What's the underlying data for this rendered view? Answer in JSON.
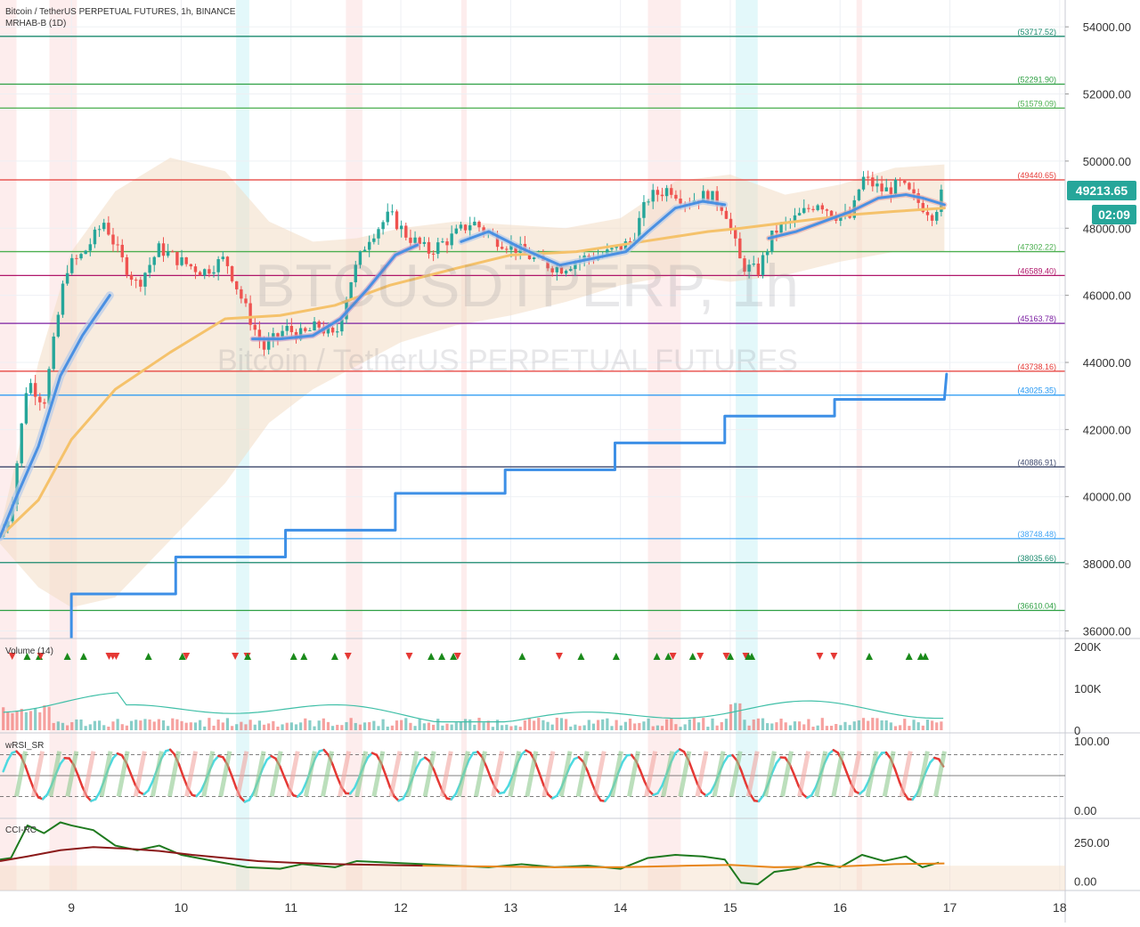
{
  "header": {
    "symbol_title": "Bitcoin / TetherUS PERPETUAL FUTURES, 1h, BINANCE",
    "indicator_title": "MRHAB-B (1D)"
  },
  "watermark": {
    "ticker": "BTCUSDTPERP, 1h",
    "name": "Bitcoin / TetherUS PERPETUAL FUTURES"
  },
  "panes": {
    "volume_label": "Volume (14)",
    "wrsi_label": "wRSI_SR",
    "cci_label": "CCI-RC"
  },
  "last_price": {
    "value": "49213.65",
    "countdown": "02:09"
  },
  "colors": {
    "up": "#26a69a",
    "down": "#ef5350",
    "ema_fast": "#4a90e2",
    "ema_slow": "#f5c26b",
    "band": "#f3dcc4",
    "step_line": "#3d8fe6",
    "cci_line": "#1f7a1f",
    "cci_signal": "#8b1a1a"
  },
  "chart_data": [
    {
      "type": "candlestick",
      "title": "Bitcoin / TetherUS PERPETUAL FUTURES, 1h, BINANCE",
      "x_ticks": [
        "9",
        "10",
        "11",
        "12",
        "13",
        "14",
        "15",
        "16",
        "17",
        "18"
      ],
      "y_ticks": [
        "54000.00",
        "52000.00",
        "50000.00",
        "48000.00",
        "46000.00",
        "44000.00",
        "42000.00",
        "40000.00",
        "38000.00",
        "36000.00"
      ],
      "ylim": [
        35800,
        54800
      ],
      "xlim": [
        8.35,
        18.05
      ],
      "price_path": [
        [
          8.35,
          38800
        ],
        [
          8.45,
          39600
        ],
        [
          8.6,
          43500
        ],
        [
          8.75,
          42800
        ],
        [
          8.95,
          46800
        ],
        [
          9.1,
          47200
        ],
        [
          9.3,
          48200
        ],
        [
          9.45,
          47100
        ],
        [
          9.6,
          46300
        ],
        [
          9.8,
          47400
        ],
        [
          10.0,
          47000
        ],
        [
          10.2,
          46700
        ],
        [
          10.4,
          47100
        ],
        [
          10.6,
          45500
        ],
        [
          10.75,
          44400
        ],
        [
          10.95,
          45000
        ],
        [
          11.1,
          44800
        ],
        [
          11.25,
          45100
        ],
        [
          11.4,
          44700
        ],
        [
          11.55,
          46500
        ],
        [
          11.7,
          47700
        ],
        [
          11.9,
          48400
        ],
        [
          12.05,
          47800
        ],
        [
          12.25,
          47300
        ],
        [
          12.45,
          47700
        ],
        [
          12.65,
          48200
        ],
        [
          12.85,
          47700
        ],
        [
          13.05,
          47400
        ],
        [
          13.25,
          47000
        ],
        [
          13.45,
          46800
        ],
        [
          13.65,
          47100
        ],
        [
          13.85,
          47200
        ],
        [
          14.1,
          47600
        ],
        [
          14.25,
          48900
        ],
        [
          14.45,
          49200
        ],
        [
          14.6,
          48800
        ],
        [
          14.8,
          49000
        ],
        [
          14.95,
          48600
        ],
        [
          15.1,
          46900
        ],
        [
          15.25,
          46700
        ],
        [
          15.4,
          47900
        ],
        [
          15.6,
          48300
        ],
        [
          15.8,
          48800
        ],
        [
          15.95,
          48400
        ],
        [
          16.1,
          48300
        ],
        [
          16.2,
          49500
        ],
        [
          16.4,
          49100
        ],
        [
          16.55,
          49300
        ],
        [
          16.7,
          48800
        ],
        [
          16.85,
          48400
        ],
        [
          16.95,
          49213.65
        ]
      ],
      "ema_fast": [
        [
          8.35,
          38800
        ],
        [
          8.5,
          40000
        ],
        [
          8.7,
          41500
        ],
        [
          8.9,
          43600
        ],
        [
          9.1,
          44800
        ],
        [
          9.35,
          46000
        ]
      ],
      "ema_fast_2": [
        [
          10.65,
          44700
        ],
        [
          10.9,
          44700
        ],
        [
          11.2,
          44800
        ],
        [
          11.45,
          45300
        ],
        [
          11.7,
          46200
        ],
        [
          11.95,
          47200
        ],
        [
          12.15,
          47500
        ]
      ],
      "ema_fast_3": [
        [
          12.55,
          47600
        ],
        [
          12.8,
          47900
        ],
        [
          13.1,
          47400
        ],
        [
          13.45,
          46900
        ],
        [
          13.75,
          47100
        ],
        [
          14.05,
          47300
        ],
        [
          14.25,
          47900
        ],
        [
          14.5,
          48600
        ],
        [
          14.75,
          48800
        ],
        [
          14.95,
          48700
        ]
      ],
      "ema_fast_4": [
        [
          15.35,
          47700
        ],
        [
          15.6,
          47900
        ],
        [
          15.85,
          48200
        ],
        [
          16.1,
          48500
        ],
        [
          16.35,
          48900
        ],
        [
          16.6,
          49000
        ],
        [
          16.75,
          48900
        ],
        [
          16.95,
          48700
        ]
      ],
      "ema_slow": [
        [
          8.35,
          38800
        ],
        [
          8.7,
          39900
        ],
        [
          9.0,
          41700
        ],
        [
          9.4,
          43200
        ],
        [
          9.9,
          44300
        ],
        [
          10.4,
          45300
        ],
        [
          10.9,
          45400
        ],
        [
          11.4,
          45700
        ],
        [
          11.9,
          46300
        ],
        [
          12.5,
          46800
        ],
        [
          13.0,
          47200
        ],
        [
          13.6,
          47300
        ],
        [
          14.2,
          47600
        ],
        [
          14.8,
          47900
        ],
        [
          15.1,
          48000
        ],
        [
          15.6,
          48200
        ],
        [
          16.1,
          48400
        ],
        [
          16.5,
          48500
        ],
        [
          16.95,
          48600
        ]
      ],
      "band_upper": [
        [
          8.35,
          39000
        ],
        [
          8.7,
          44000
        ],
        [
          9.0,
          47300
        ],
        [
          9.4,
          49100
        ],
        [
          9.9,
          50100
        ],
        [
          10.4,
          49700
        ],
        [
          10.8,
          48200
        ],
        [
          11.2,
          47600
        ],
        [
          11.6,
          47700
        ],
        [
          12.0,
          48000
        ],
        [
          12.5,
          48200
        ],
        [
          13.0,
          48100
        ],
        [
          13.5,
          48000
        ],
        [
          14.0,
          48300
        ],
        [
          14.5,
          49400
        ],
        [
          15.0,
          49600
        ],
        [
          15.5,
          49000
        ],
        [
          16.0,
          49300
        ],
        [
          16.5,
          49800
        ],
        [
          16.95,
          49900
        ]
      ],
      "band_lower": [
        [
          16.95,
          47300
        ],
        [
          16.5,
          47300
        ],
        [
          16.0,
          47000
        ],
        [
          15.5,
          46600
        ],
        [
          15.0,
          46400
        ],
        [
          14.5,
          46600
        ],
        [
          14.0,
          46300
        ],
        [
          13.5,
          45800
        ],
        [
          13.0,
          45400
        ],
        [
          12.5,
          45100
        ],
        [
          12.0,
          44600
        ],
        [
          11.6,
          43900
        ],
        [
          11.2,
          43200
        ],
        [
          10.8,
          42200
        ],
        [
          10.4,
          40400
        ],
        [
          9.9,
          38700
        ],
        [
          9.4,
          37000
        ],
        [
          9.0,
          36700
        ],
        [
          8.7,
          37300
        ],
        [
          8.35,
          38600
        ]
      ],
      "step_line": [
        [
          9.0,
          35800
        ],
        [
          9.0,
          37100
        ],
        [
          9.95,
          37100
        ],
        [
          9.95,
          38200
        ],
        [
          10.95,
          38200
        ],
        [
          10.95,
          39000
        ],
        [
          11.95,
          39000
        ],
        [
          11.95,
          40100
        ],
        [
          12.95,
          40100
        ],
        [
          12.95,
          40800
        ],
        [
          13.95,
          40800
        ],
        [
          13.95,
          41600
        ],
        [
          14.95,
          41600
        ],
        [
          14.95,
          42400
        ],
        [
          15.95,
          42400
        ],
        [
          15.95,
          42900
        ],
        [
          16.95,
          42900
        ],
        [
          16.97,
          43650
        ]
      ],
      "levels": [
        {
          "value": 53717.52,
          "label": "(53717.52)",
          "color": "#1a8a6e"
        },
        {
          "value": 52291.9,
          "label": "(52291.90)",
          "color": "#2ea043"
        },
        {
          "value": 51579.09,
          "label": "(51579.09)",
          "color": "#4caf50"
        },
        {
          "value": 49440.65,
          "label": "(49440.65)",
          "color": "#e53935"
        },
        {
          "value": 47302.22,
          "label": "(47302.22)",
          "color": "#4caf50"
        },
        {
          "value": 46589.4,
          "label": "(46589.40)",
          "color": "#b0176b"
        },
        {
          "value": 45163.78,
          "label": "(45163.78)",
          "color": "#7b1fa2"
        },
        {
          "value": 43738.16,
          "label": "(43738.16)",
          "color": "#e53935"
        },
        {
          "value": 43025.35,
          "label": "(43025.35)",
          "color": "#2196f3"
        },
        {
          "value": 40886.91,
          "label": "(40886.91)",
          "color": "#3f4a6e"
        },
        {
          "value": 38748.48,
          "label": "(38748.48)",
          "color": "#42a5f5"
        },
        {
          "value": 38035.66,
          "label": "(38035.66)",
          "color": "#1a8a6e"
        },
        {
          "value": 36610.04,
          "label": "(36610.04)",
          "color": "#2ea043"
        }
      ],
      "highlight_bands": [
        {
          "x0": 8.35,
          "x1": 8.5,
          "kind": "red"
        },
        {
          "x0": 8.8,
          "x1": 9.05,
          "kind": "red"
        },
        {
          "x0": 10.5,
          "x1": 10.62,
          "kind": "blue"
        },
        {
          "x0": 11.5,
          "x1": 11.65,
          "kind": "red"
        },
        {
          "x0": 12.55,
          "x1": 12.6,
          "kind": "red"
        },
        {
          "x0": 14.25,
          "x1": 14.55,
          "kind": "red"
        },
        {
          "x0": 15.05,
          "x1": 15.25,
          "kind": "blue"
        },
        {
          "x0": 16.15,
          "x1": 16.2,
          "kind": "red"
        }
      ]
    },
    {
      "type": "bar",
      "title": "Volume (14)",
      "y_ticks": [
        "200K",
        "100K",
        "0"
      ],
      "ylim": [
        0,
        200000
      ]
    },
    {
      "type": "line",
      "title": "wRSI_SR",
      "y_ticks": [
        "100.00",
        "0.00"
      ],
      "ylim": [
        0,
        100
      ],
      "guide_levels": [
        80,
        50,
        20
      ]
    },
    {
      "type": "line",
      "title": "CCI-RC",
      "y_ticks": [
        "250.00",
        "0.00"
      ],
      "ylim": [
        -60,
        400
      ],
      "cci": [
        [
          8.35,
          140
        ],
        [
          8.45,
          150
        ],
        [
          8.6,
          360
        ],
        [
          8.75,
          310
        ],
        [
          8.9,
          380
        ],
        [
          9.0,
          360
        ],
        [
          9.2,
          330
        ],
        [
          9.4,
          230
        ],
        [
          9.6,
          200
        ],
        [
          9.8,
          230
        ],
        [
          10.0,
          170
        ],
        [
          10.3,
          130
        ],
        [
          10.6,
          90
        ],
        [
          10.9,
          80
        ],
        [
          11.1,
          110
        ],
        [
          11.4,
          90
        ],
        [
          11.6,
          130
        ],
        [
          11.9,
          120
        ],
        [
          12.2,
          110
        ],
        [
          12.5,
          100
        ],
        [
          12.8,
          90
        ],
        [
          13.1,
          110
        ],
        [
          13.4,
          90
        ],
        [
          13.7,
          100
        ],
        [
          14.0,
          80
        ],
        [
          14.25,
          150
        ],
        [
          14.5,
          170
        ],
        [
          14.75,
          160
        ],
        [
          14.95,
          140
        ],
        [
          15.1,
          -10
        ],
        [
          15.25,
          -20
        ],
        [
          15.4,
          60
        ],
        [
          15.6,
          80
        ],
        [
          15.8,
          120
        ],
        [
          16.0,
          90
        ],
        [
          16.2,
          170
        ],
        [
          16.4,
          130
        ],
        [
          16.6,
          160
        ],
        [
          16.75,
          90
        ],
        [
          16.9,
          120
        ]
      ],
      "cci_signal": [
        [
          8.35,
          130
        ],
        [
          8.6,
          160
        ],
        [
          8.9,
          200
        ],
        [
          9.2,
          220
        ],
        [
          9.5,
          210
        ],
        [
          9.8,
          195
        ],
        [
          10.1,
          170
        ],
        [
          10.4,
          150
        ],
        [
          10.7,
          130
        ],
        [
          11.0,
          120
        ],
        [
          11.4,
          110
        ],
        [
          11.8,
          105
        ],
        [
          12.2,
          100
        ]
      ],
      "cci_signal_2": [
        [
          12.2,
          100
        ],
        [
          12.8,
          95
        ],
        [
          13.4,
          90
        ],
        [
          14.0,
          90
        ],
        [
          14.6,
          100
        ],
        [
          15.0,
          105
        ],
        [
          15.4,
          90
        ],
        [
          16.0,
          95
        ],
        [
          16.5,
          110
        ],
        [
          16.95,
          115
        ]
      ]
    }
  ]
}
